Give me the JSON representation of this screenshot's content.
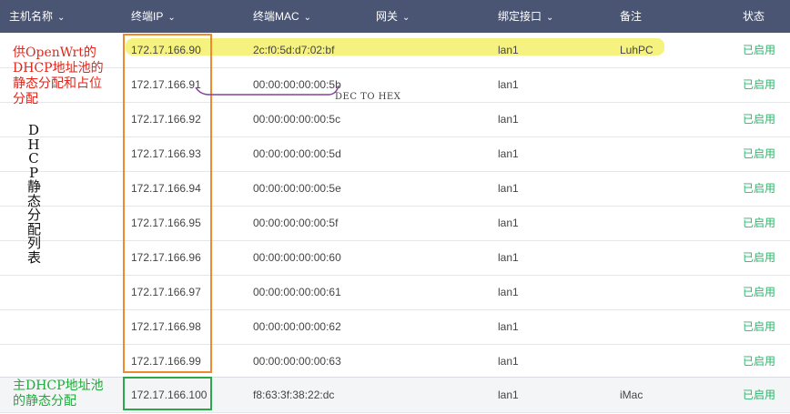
{
  "header": {
    "columns": [
      {
        "label": "主机名称",
        "sortable": true
      },
      {
        "label": "终端IP",
        "sortable": true
      },
      {
        "label": "终端MAC",
        "sortable": true
      },
      {
        "label": "网关",
        "sortable": true
      },
      {
        "label": "绑定接口",
        "sortable": true
      },
      {
        "label": "备注",
        "sortable": false
      },
      {
        "label": "状态",
        "sortable": false
      }
    ]
  },
  "rows": [
    {
      "ip": "172.17.166.90",
      "mac": "2c:f0:5d:d7:02:bf",
      "interface": "lan1",
      "note": "LuhPC",
      "status": "已启用"
    },
    {
      "ip": "172.17.166.91",
      "mac": "00:00:00:00:00:5b",
      "interface": "lan1",
      "note": "",
      "status": "已启用"
    },
    {
      "ip": "172.17.166.92",
      "mac": "00:00:00:00:00:5c",
      "interface": "lan1",
      "note": "",
      "status": "已启用"
    },
    {
      "ip": "172.17.166.93",
      "mac": "00:00:00:00:00:5d",
      "interface": "lan1",
      "note": "",
      "status": "已启用"
    },
    {
      "ip": "172.17.166.94",
      "mac": "00:00:00:00:00:5e",
      "interface": "lan1",
      "note": "",
      "status": "已启用"
    },
    {
      "ip": "172.17.166.95",
      "mac": "00:00:00:00:00:5f",
      "interface": "lan1",
      "note": "",
      "status": "已启用"
    },
    {
      "ip": "172.17.166.96",
      "mac": "00:00:00:00:00:60",
      "interface": "lan1",
      "note": "",
      "status": "已启用"
    },
    {
      "ip": "172.17.166.97",
      "mac": "00:00:00:00:00:61",
      "interface": "lan1",
      "note": "",
      "status": "已启用"
    },
    {
      "ip": "172.17.166.98",
      "mac": "00:00:00:00:00:62",
      "interface": "lan1",
      "note": "",
      "status": "已启用"
    },
    {
      "ip": "172.17.166.99",
      "mac": "00:00:00:00:00:63",
      "interface": "lan1",
      "note": "",
      "status": "已启用"
    },
    {
      "ip": "172.17.166.100",
      "mac": "f8:63:3f:38:22:dc",
      "interface": "lan1",
      "note": "iMac",
      "status": "已启用"
    }
  ],
  "annotations": {
    "red_note": "供OpenWrt的DHCP地址池的静态分配和占位分配",
    "vertical_note": "DHCP静态分配列表",
    "green_note": "主DHCP地址池的静态分配",
    "hex_note": "DEC TO HEX"
  },
  "colors": {
    "header_bg": "#4a5574",
    "status_green": "#2db46b",
    "highlight_yellow": "#f4f06a",
    "annotation_red": "#e0261a",
    "annotation_green": "#1faa3a",
    "box_orange": "#ef8a2c",
    "box_green": "#2ba84a",
    "line_purple": "#8a3fa0"
  },
  "icons": {
    "sort": "chevron-down-icon"
  }
}
